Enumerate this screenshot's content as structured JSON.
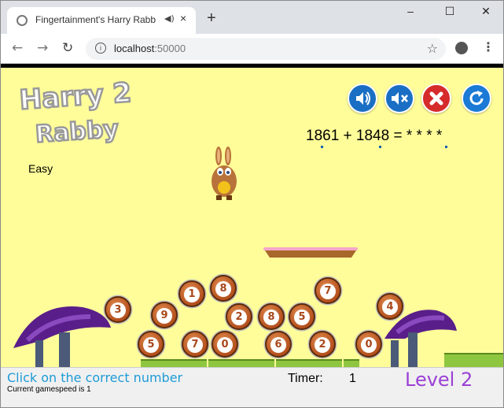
{
  "browser": {
    "tab_title": "Fingertainment's Harry Rabb",
    "tab_audio_icon": "speaker-icon",
    "tab_close": "×",
    "new_tab": "+",
    "minimize": "–",
    "maximize": "☐",
    "close": "✕",
    "back": "←",
    "forward": "→",
    "reload": "↻",
    "info_icon": "i",
    "url_host": "localhost",
    "url_port": ":50000",
    "bookmark_star": "☆",
    "menu": "⋮"
  },
  "game": {
    "logo_line1": "Harry 2",
    "logo_line2": "Rabby",
    "difficulty": "Easy",
    "equation": "1861 + 1848 =  *  * * *",
    "controls": [
      {
        "name": "sound-on-button",
        "icon": "speaker-on-icon",
        "glyph": "🔊",
        "color": "#1a6fc4"
      },
      {
        "name": "mute-button",
        "icon": "speaker-mute-icon",
        "glyph": "✕",
        "color": "#1a6fc4"
      },
      {
        "name": "close-game-button",
        "icon": "close-icon",
        "glyph": "✖",
        "color": "#d62b2b"
      },
      {
        "name": "restart-button",
        "icon": "restart-icon",
        "glyph": "↻",
        "color": "#1a7ad6"
      }
    ],
    "balls": [
      "3",
      "9",
      "1",
      "8",
      "2",
      "8",
      "5",
      "7",
      "4",
      "5",
      "7",
      "0",
      "6",
      "2",
      "0"
    ]
  },
  "status": {
    "instruction": "Click on the correct number",
    "speed": "Current gamespeed is 1",
    "timer_label": "Timer:",
    "timer_value": "1",
    "level": "Level 2"
  }
}
